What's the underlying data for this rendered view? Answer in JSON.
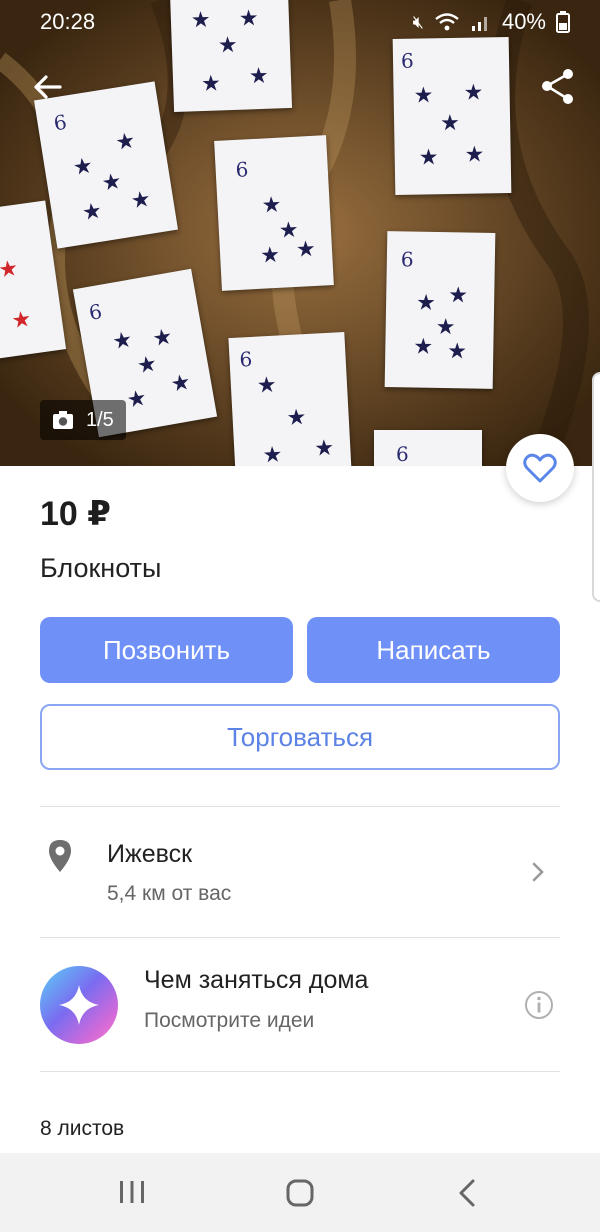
{
  "status_bar": {
    "time": "20:28",
    "battery": "40%",
    "icons": [
      "mute-icon",
      "wifi-icon",
      "signal-icon",
      "battery-icon"
    ]
  },
  "gallery": {
    "counter": "1/5",
    "counter_icon": "camera-icon"
  },
  "listing": {
    "price": "10 ₽",
    "title": "Блокноты"
  },
  "actions": {
    "call_label": "Позвонить",
    "write_label": "Написать",
    "bargain_label": "Торговаться"
  },
  "location": {
    "city": "Ижевск",
    "distance": "5,4 км от вас"
  },
  "promo": {
    "title": "Чем заняться дома",
    "subtitle": "Посмотрите идеи"
  },
  "description": {
    "text": "8 листов"
  },
  "colors": {
    "accent": "#6f91f7",
    "accent_text": "#5c82e6",
    "favorite": "#5a86e8"
  }
}
